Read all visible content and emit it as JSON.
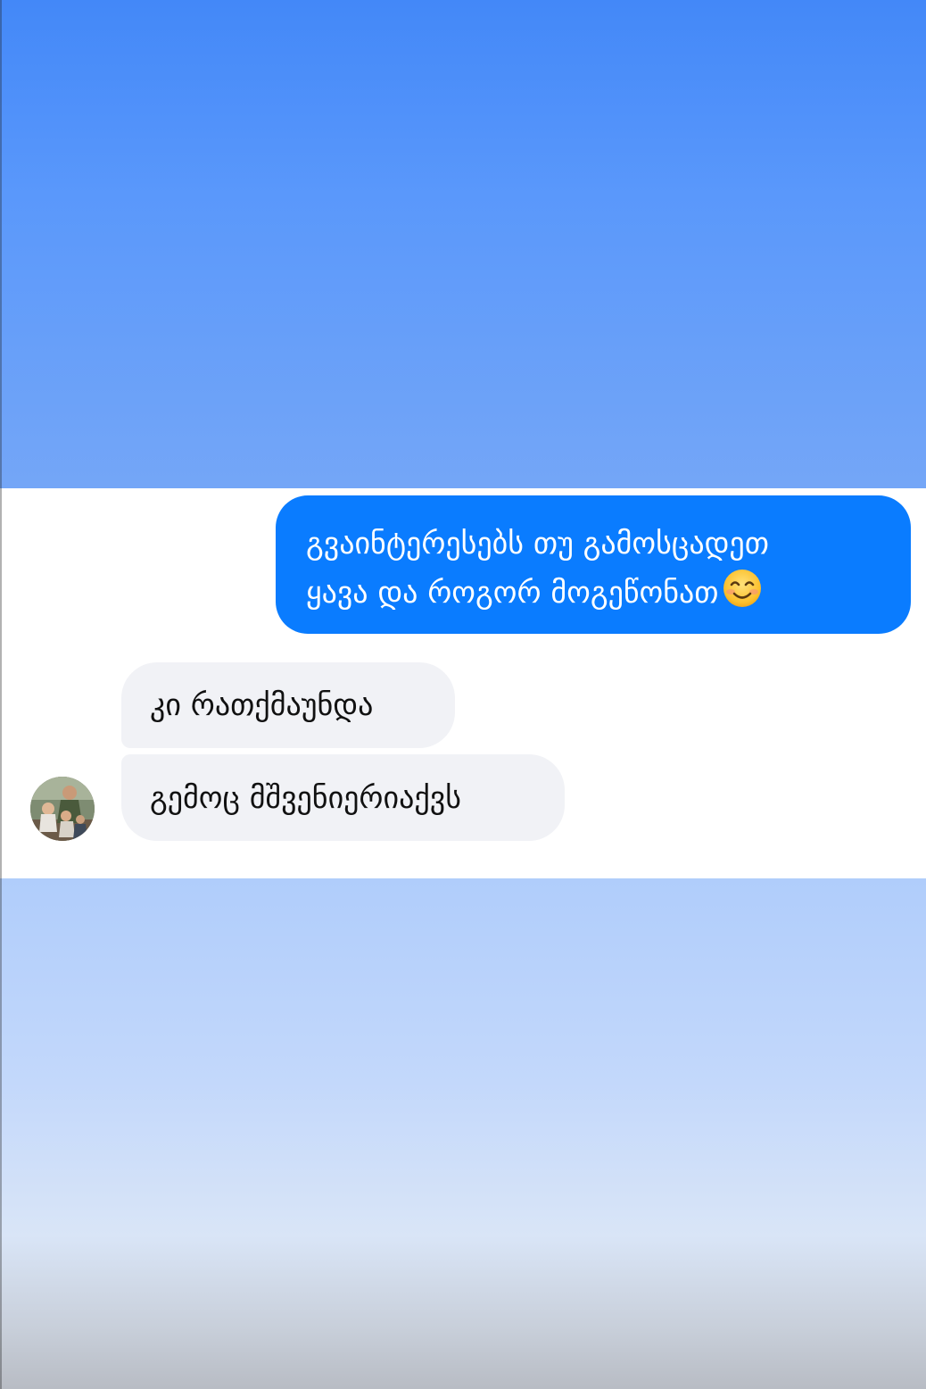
{
  "conversation": {
    "sent_message": {
      "line1": "გვაინტერესებს თუ გამოსცადეთ",
      "line2": "ყავა და როგორ მოგეწონათ",
      "emoji": "smiling-face-icon"
    },
    "received_messages": [
      {
        "text": "კი რათქმაუნდა"
      },
      {
        "text": "გემოც მშვენიერიაქვს"
      }
    ],
    "avatar_icon": "user-photo-avatar"
  },
  "colors": {
    "sent_bubble": "#0a7cff",
    "received_bubble": "#f1f2f6",
    "background_top": "#4388f8",
    "background_bottom": "#c3d8fb"
  }
}
